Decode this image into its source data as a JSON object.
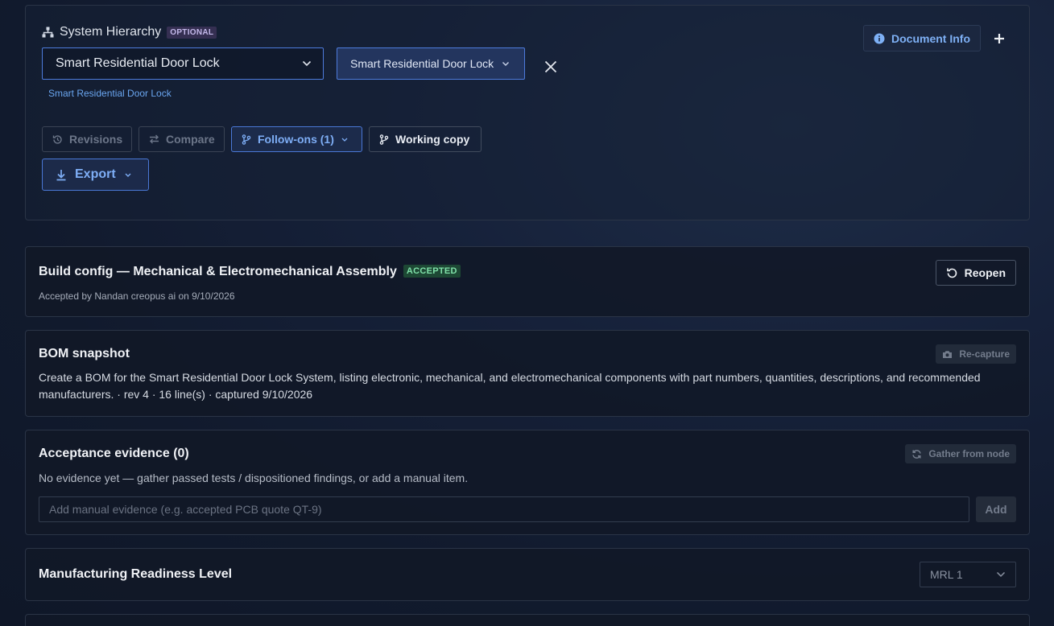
{
  "hierarchy": {
    "title": "System Hierarchy",
    "optional_badge": "OPTIONAL",
    "selected_system": "Smart Residential Door Lock",
    "selected_chip": "Smart Residential Door Lock",
    "breadcrumb": "Smart Residential Door Lock",
    "doc_info_label": "Document Info"
  },
  "toolbar": {
    "revisions_label": "Revisions",
    "compare_label": "Compare",
    "follow_ons_label": "Follow-ons (1)",
    "working_copy_label": "Working copy",
    "export_label": "Export"
  },
  "build_config": {
    "title": "Build config — Mechanical & Electromechanical Assembly",
    "status_badge": "ACCEPTED",
    "accepted_line": "Accepted by Nandan creopus ai on 9/10/2026",
    "reopen_label": "Reopen"
  },
  "bom": {
    "title": "BOM snapshot",
    "recapture_label": "Re-capture",
    "description": "Create a BOM for the Smart Residential Door Lock System, listing electronic, mechanical, and electromechanical components with part numbers, quantities, descriptions, and recommended manufacturers. · rev 4 · 16 line(s) · captured 9/10/2026"
  },
  "evidence": {
    "title": "Acceptance evidence (0)",
    "gather_label": "Gather from node",
    "empty_text": "No evidence yet — gather passed tests / dispositioned findings, or add a manual item.",
    "input_value": "",
    "input_placeholder": "Add manual evidence (e.g. accepted PCB quote QT-9)",
    "add_label": "Add"
  },
  "mrl": {
    "title": "Manufacturing Readiness Level",
    "selected": "MRL 1"
  },
  "colors": {
    "accent": "#4d7bdc",
    "accent_text": "#7eaef6",
    "accepted_green": "#7fe0a8",
    "optional_purple": "#c3b8ea"
  },
  "icons": [
    "hierarchy-icon",
    "chevron-down-icon",
    "close-icon",
    "info-icon",
    "plus-icon",
    "history-icon",
    "compare-icon",
    "branch-icon",
    "download-icon",
    "reopen-icon",
    "camera-icon",
    "refresh-icon"
  ]
}
